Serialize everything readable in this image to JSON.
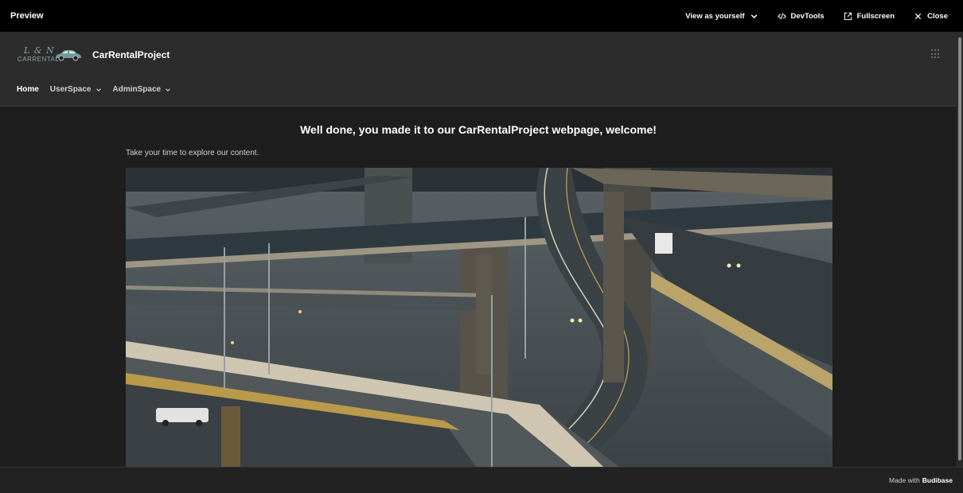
{
  "preview_bar": {
    "title": "Preview",
    "view_as": "View as yourself",
    "devtools": "DevTools",
    "fullscreen": "Fullscreen",
    "close": "Close"
  },
  "app": {
    "logo_initials": "L & N",
    "logo_caption": "CARRENTAL",
    "name": "CarRentalProject",
    "nav": [
      {
        "label": "Home",
        "active": true
      },
      {
        "label": "UserSpace",
        "dropdown": true
      },
      {
        "label": "AdminSpace",
        "dropdown": true
      }
    ],
    "heading": "Well done, you made it to our CarRentalProject webpage, welcome!",
    "paragraph": "Take your time to explore our content."
  },
  "footer": {
    "prefix": "Made with",
    "brand": "Budibase"
  },
  "icons": [
    "chevron-down-icon",
    "code-icon",
    "external-link-icon",
    "close-icon",
    "grid-menu-icon",
    "car-icon"
  ],
  "colors": {
    "topbar_bg": "#000000",
    "header_bg": "#2c2c2c",
    "body_bg": "#1e1e1e",
    "logo_teal": "#7fa9a3"
  }
}
